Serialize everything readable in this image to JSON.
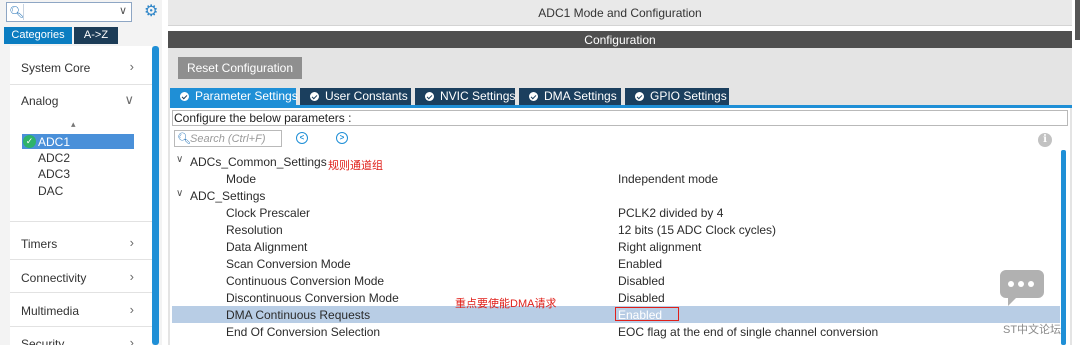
{
  "window_title": "ADC1 Mode and Configuration",
  "configuration_label": "Configuration",
  "left_panel": {
    "category_tabs": [
      "Categories",
      "A->Z"
    ],
    "categories": [
      {
        "label": "System Core"
      },
      {
        "label": "Analog"
      },
      {
        "label": "Timers"
      },
      {
        "label": "Connectivity"
      },
      {
        "label": "Multimedia"
      },
      {
        "label": "Security"
      }
    ],
    "analog_peripherals": [
      "ADC1",
      "ADC2",
      "ADC3",
      "DAC"
    ]
  },
  "reset_button": "Reset Configuration",
  "tabs": [
    "Parameter Settings",
    "User Constants",
    "NVIC Settings",
    "DMA Settings",
    "GPIO Settings"
  ],
  "configure_label": "Configure the below parameters :",
  "search_placeholder": "Search (Ctrl+F)",
  "parameters": [
    {
      "name": "ADCs_Common_Settings",
      "value": "",
      "group": true
    },
    {
      "name": "Mode",
      "value": "Independent mode"
    },
    {
      "name": "ADC_Settings",
      "value": "",
      "group": true
    },
    {
      "name": "Clock Prescaler",
      "value": "PCLK2 divided by 4"
    },
    {
      "name": "Resolution",
      "value": "12 bits (15 ADC Clock cycles)"
    },
    {
      "name": "Data Alignment",
      "value": "Right alignment"
    },
    {
      "name": "Scan Conversion Mode",
      "value": "Enabled"
    },
    {
      "name": "Continuous Conversion Mode",
      "value": "Disabled"
    },
    {
      "name": "Discontinuous Conversion Mode",
      "value": "Disabled"
    },
    {
      "name": "DMA Continuous Requests",
      "value": "Enabled",
      "selected": true
    },
    {
      "name": "End Of Conversion Selection",
      "value": "EOC flag at the end of single channel conversion"
    }
  ],
  "annotations": {
    "group_note": "规则通道组",
    "dma_note": "重点要使能DMA请求"
  },
  "watermark": "ST中文论坛",
  "colors": {
    "accent_blue": "#1f8fd6",
    "dark_tab": "#1b3f5e",
    "annotation_red": "#e0201a",
    "selected_row": "#b8cde5"
  }
}
